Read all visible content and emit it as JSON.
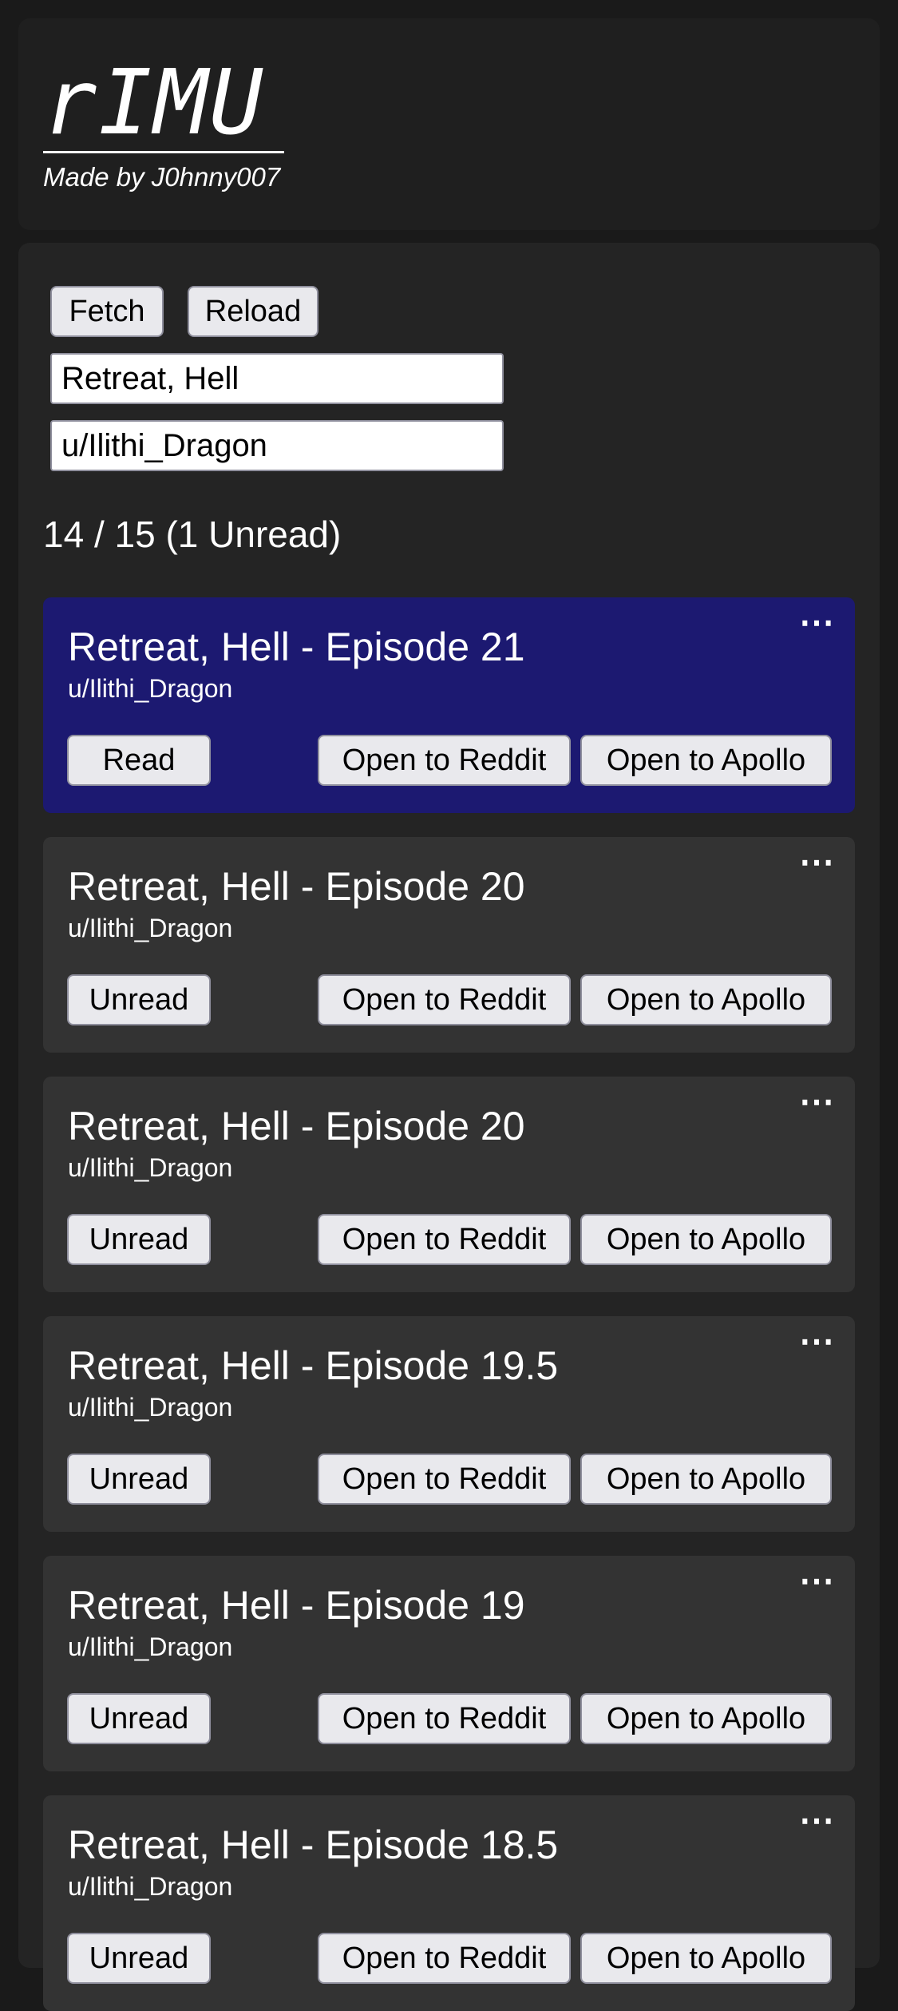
{
  "header": {
    "logo": "rIMU",
    "subtitle": "Made by J0hnny007"
  },
  "controls": {
    "fetch_label": "Fetch",
    "reload_label": "Reload",
    "series_value": "Retreat, Hell",
    "author_value": "u/Ilithi_Dragon"
  },
  "status": {
    "count_text": "14 / 15 (1 Unread)"
  },
  "colors": {
    "unread_card": "#1c1971",
    "read_card": "#333333",
    "background": "#1a1a1a"
  },
  "posts": [
    {
      "title": "Retreat, Hell - Episode 21",
      "author": "u/Ilithi_Dragon",
      "status_button": "Read",
      "reddit_button": "Open to Reddit",
      "apollo_button": "Open to Apollo",
      "menu": "⋯"
    },
    {
      "title": "Retreat, Hell - Episode 20",
      "author": "u/Ilithi_Dragon",
      "status_button": "Unread",
      "reddit_button": "Open to Reddit",
      "apollo_button": "Open to Apollo",
      "menu": "⋯"
    },
    {
      "title": "Retreat, Hell - Episode 20",
      "author": "u/Ilithi_Dragon",
      "status_button": "Unread",
      "reddit_button": "Open to Reddit",
      "apollo_button": "Open to Apollo",
      "menu": "⋯"
    },
    {
      "title": "Retreat, Hell - Episode 19.5",
      "author": "u/Ilithi_Dragon",
      "status_button": "Unread",
      "reddit_button": "Open to Reddit",
      "apollo_button": "Open to Apollo",
      "menu": "⋯"
    },
    {
      "title": "Retreat, Hell - Episode 19",
      "author": "u/Ilithi_Dragon",
      "status_button": "Unread",
      "reddit_button": "Open to Reddit",
      "apollo_button": "Open to Apollo",
      "menu": "⋯"
    },
    {
      "title": "Retreat, Hell - Episode 18.5",
      "author": "u/Ilithi_Dragon",
      "status_button": "Unread",
      "reddit_button": "Open to Reddit",
      "apollo_button": "Open to Apollo",
      "menu": "⋯"
    }
  ]
}
